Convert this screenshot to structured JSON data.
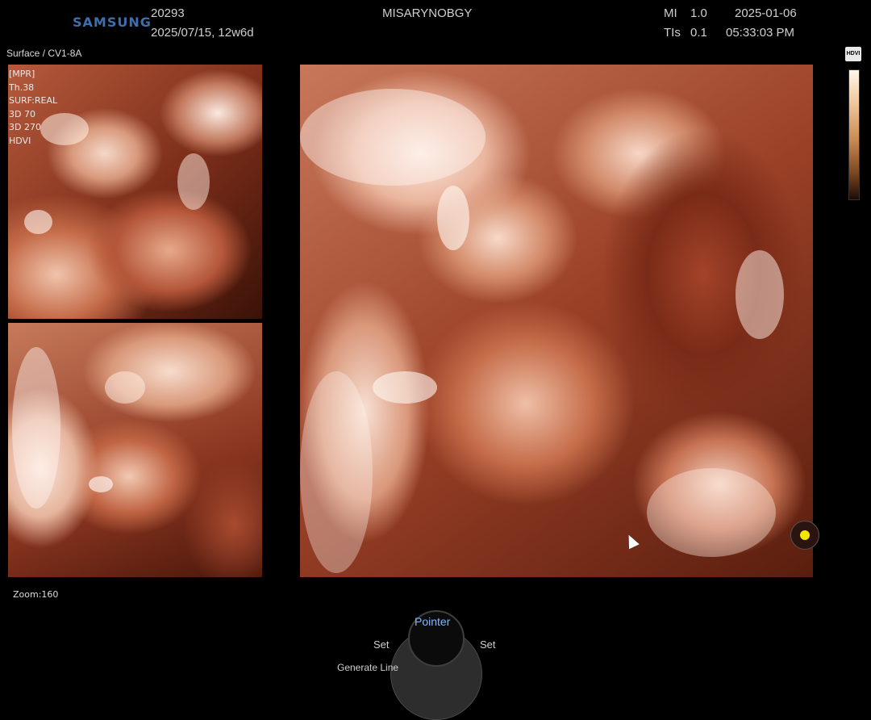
{
  "header": {
    "brand": "SAMSUNG",
    "patient_id": "20293",
    "exam_date_ga": "2025/07/15, 12w6d",
    "institution": "MISARYNOBGY",
    "mi_label": "MI",
    "mi_value": "1.0",
    "tis_label": "TIs",
    "tis_value": "0.1",
    "date": "2025-01-06",
    "time": "05:33:03 PM"
  },
  "probe_mode": "Surface / CV1-8A",
  "overlay": {
    "lines": [
      "[MPR]",
      "Th.38",
      "SURF:REAL",
      "3D 70",
      "3D 270",
      "HDVI"
    ]
  },
  "side_badge": "HDVI",
  "zoom": "Zoom:160",
  "controls": {
    "pointer": "Pointer",
    "set_left": "Set",
    "set_right": "Set",
    "generate_line": "Generate Line"
  }
}
